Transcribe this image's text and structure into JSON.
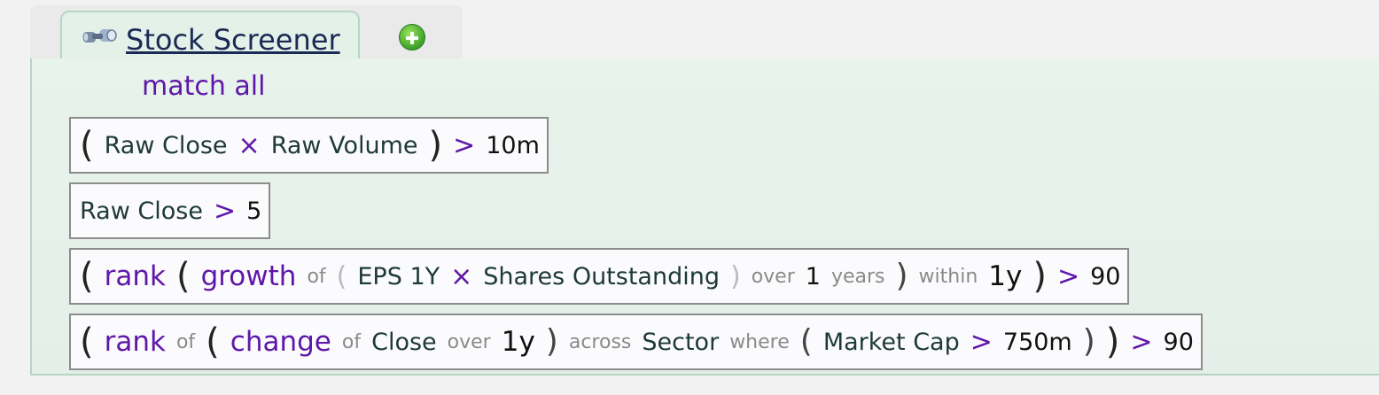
{
  "tab": {
    "label": "Stock Screener",
    "icon": "binoculars-icon",
    "add_icon": "plus-circle-icon"
  },
  "match_label": "match all",
  "rule1": {
    "p1": "(",
    "field1": "Raw Close",
    "op1": "×",
    "field2": "Raw Volume",
    "p2": ")",
    "cmp": ">",
    "value": "10m"
  },
  "rule2": {
    "field": "Raw Close",
    "cmp": ">",
    "value": "5"
  },
  "rule3": {
    "p1": "(",
    "rank": "rank",
    "p2": "(",
    "growth": "growth",
    "of": "of",
    "p3": "(",
    "field1": "EPS 1Y",
    "op": "×",
    "field2": "Shares Outstanding",
    "p4": ")",
    "over": "over",
    "n": "1",
    "years": "years",
    "p5": ")",
    "within": "within",
    "period": "1y",
    "p6": ")",
    "cmp": ">",
    "value": "90"
  },
  "rule4": {
    "p1": "(",
    "rank": "rank",
    "of1": "of",
    "p2": "(",
    "change": "change",
    "of2": "of",
    "field": "Close",
    "over": "over",
    "period": "1y",
    "p3": ")",
    "across": "across",
    "group": "Sector",
    "where": "where",
    "p4": "(",
    "cond_field": "Market Cap",
    "cond_cmp": ">",
    "cond_value": "750m",
    "p5": ")",
    "p6": ")",
    "cmp": ">",
    "value": "90"
  },
  "colors": {
    "purple": "#5e17a8",
    "panel_bg": "#e8f3ec",
    "panel_border": "#b5d6c2"
  }
}
